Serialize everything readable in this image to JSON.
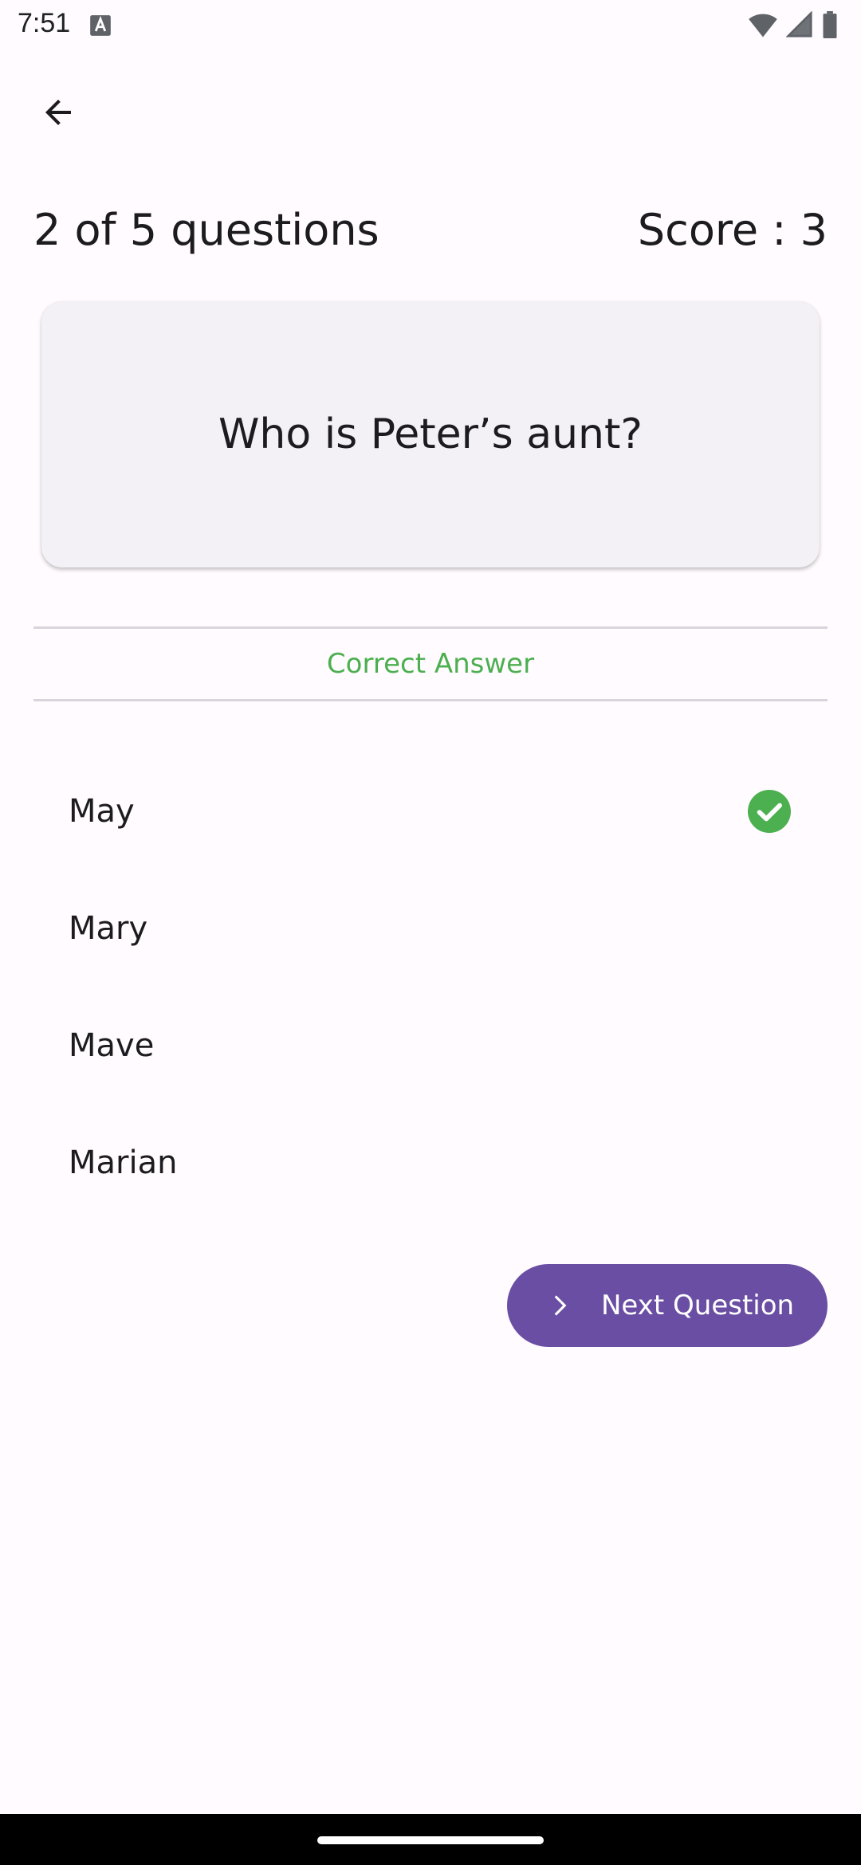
{
  "status_bar": {
    "time": "7:51",
    "icons": [
      "font-app-icon",
      "wifi-icon",
      "cell-signal-icon",
      "battery-icon"
    ]
  },
  "app_bar": {
    "back_icon": "arrow-back-icon"
  },
  "quiz": {
    "progress_text": "2 of 5 questions",
    "score_text": "Score : 3",
    "question": "Who is Peter’s aunt?",
    "feedback": "Correct Answer",
    "feedback_color": "#4caf50",
    "answers": [
      {
        "label": "May",
        "selected": true,
        "status_icon": "check-circle-icon"
      },
      {
        "label": "Mary",
        "selected": false
      },
      {
        "label": "Mave",
        "selected": false
      },
      {
        "label": "Marian",
        "selected": false
      }
    ],
    "next_button": {
      "label": "Next Question",
      "icon": "chevron-right-icon",
      "color": "#6a4ea3"
    }
  },
  "colors": {
    "background": "#fffbfe",
    "card": "#f4f1f6",
    "accent": "#6a4ea3",
    "success": "#4caf50"
  }
}
